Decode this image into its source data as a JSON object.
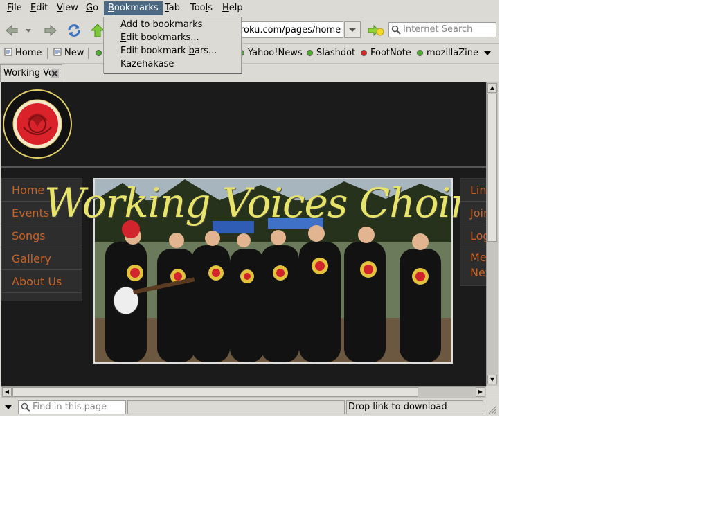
{
  "menubar": {
    "items": [
      {
        "label": "File",
        "u": "F",
        "rest": "ile"
      },
      {
        "label": "Edit",
        "u": "E",
        "rest": "dit"
      },
      {
        "label": "View",
        "u": "V",
        "rest": "iew"
      },
      {
        "label": "Go",
        "u": "G",
        "rest": "o"
      },
      {
        "label": "Bookmarks",
        "u": "B",
        "rest": "ookmarks"
      },
      {
        "label": "Tab",
        "u": "T",
        "rest": "ab"
      },
      {
        "label": "Tools",
        "pre": "Too",
        "u": "l",
        "rest": "s"
      },
      {
        "label": "Help",
        "u": "H",
        "rest": "elp"
      }
    ],
    "active": "Bookmarks"
  },
  "bookmarks_menu": {
    "items": [
      {
        "pre": "",
        "u": "A",
        "rest": "dd to bookmarks"
      },
      {
        "pre": "",
        "u": "E",
        "rest": "dit bookmarks..."
      },
      {
        "pre": "Edit bookmark ",
        "u": "b",
        "rest": "ars..."
      },
      {
        "pre": "Kazehakase",
        "u": "",
        "rest": ""
      }
    ]
  },
  "toolbar": {
    "url_visible": "roku.com/pages/home",
    "search_placeholder": "Internet Search"
  },
  "bookmarks_bar": {
    "items": [
      {
        "label": "Home",
        "icon": "page-icon"
      },
      {
        "label": "New",
        "icon": "page-icon"
      },
      {
        "label": "Yahoo!News",
        "icon": "green-dot",
        "color": "#4caf2a"
      },
      {
        "label": "Slashdot",
        "icon": "green-dot",
        "color": "#4caf2a"
      },
      {
        "label": "FootNote",
        "icon": "red-dot",
        "color": "#d8261e"
      },
      {
        "label": "mozillaZine",
        "icon": "green-dot",
        "color": "#4caf2a"
      }
    ]
  },
  "tabs": [
    {
      "title": "Working Vo"
    }
  ],
  "website": {
    "title": "Working Voices Choir",
    "nav_left": [
      "Home",
      "Events",
      "Songs",
      "Gallery",
      "About Us"
    ],
    "nav_right": [
      "Link",
      "Join",
      "Log",
      "Me",
      "Nev"
    ],
    "accent": "#c86428"
  },
  "statusbar": {
    "find_placeholder": "Find in this page",
    "message": "Drop link to download"
  }
}
